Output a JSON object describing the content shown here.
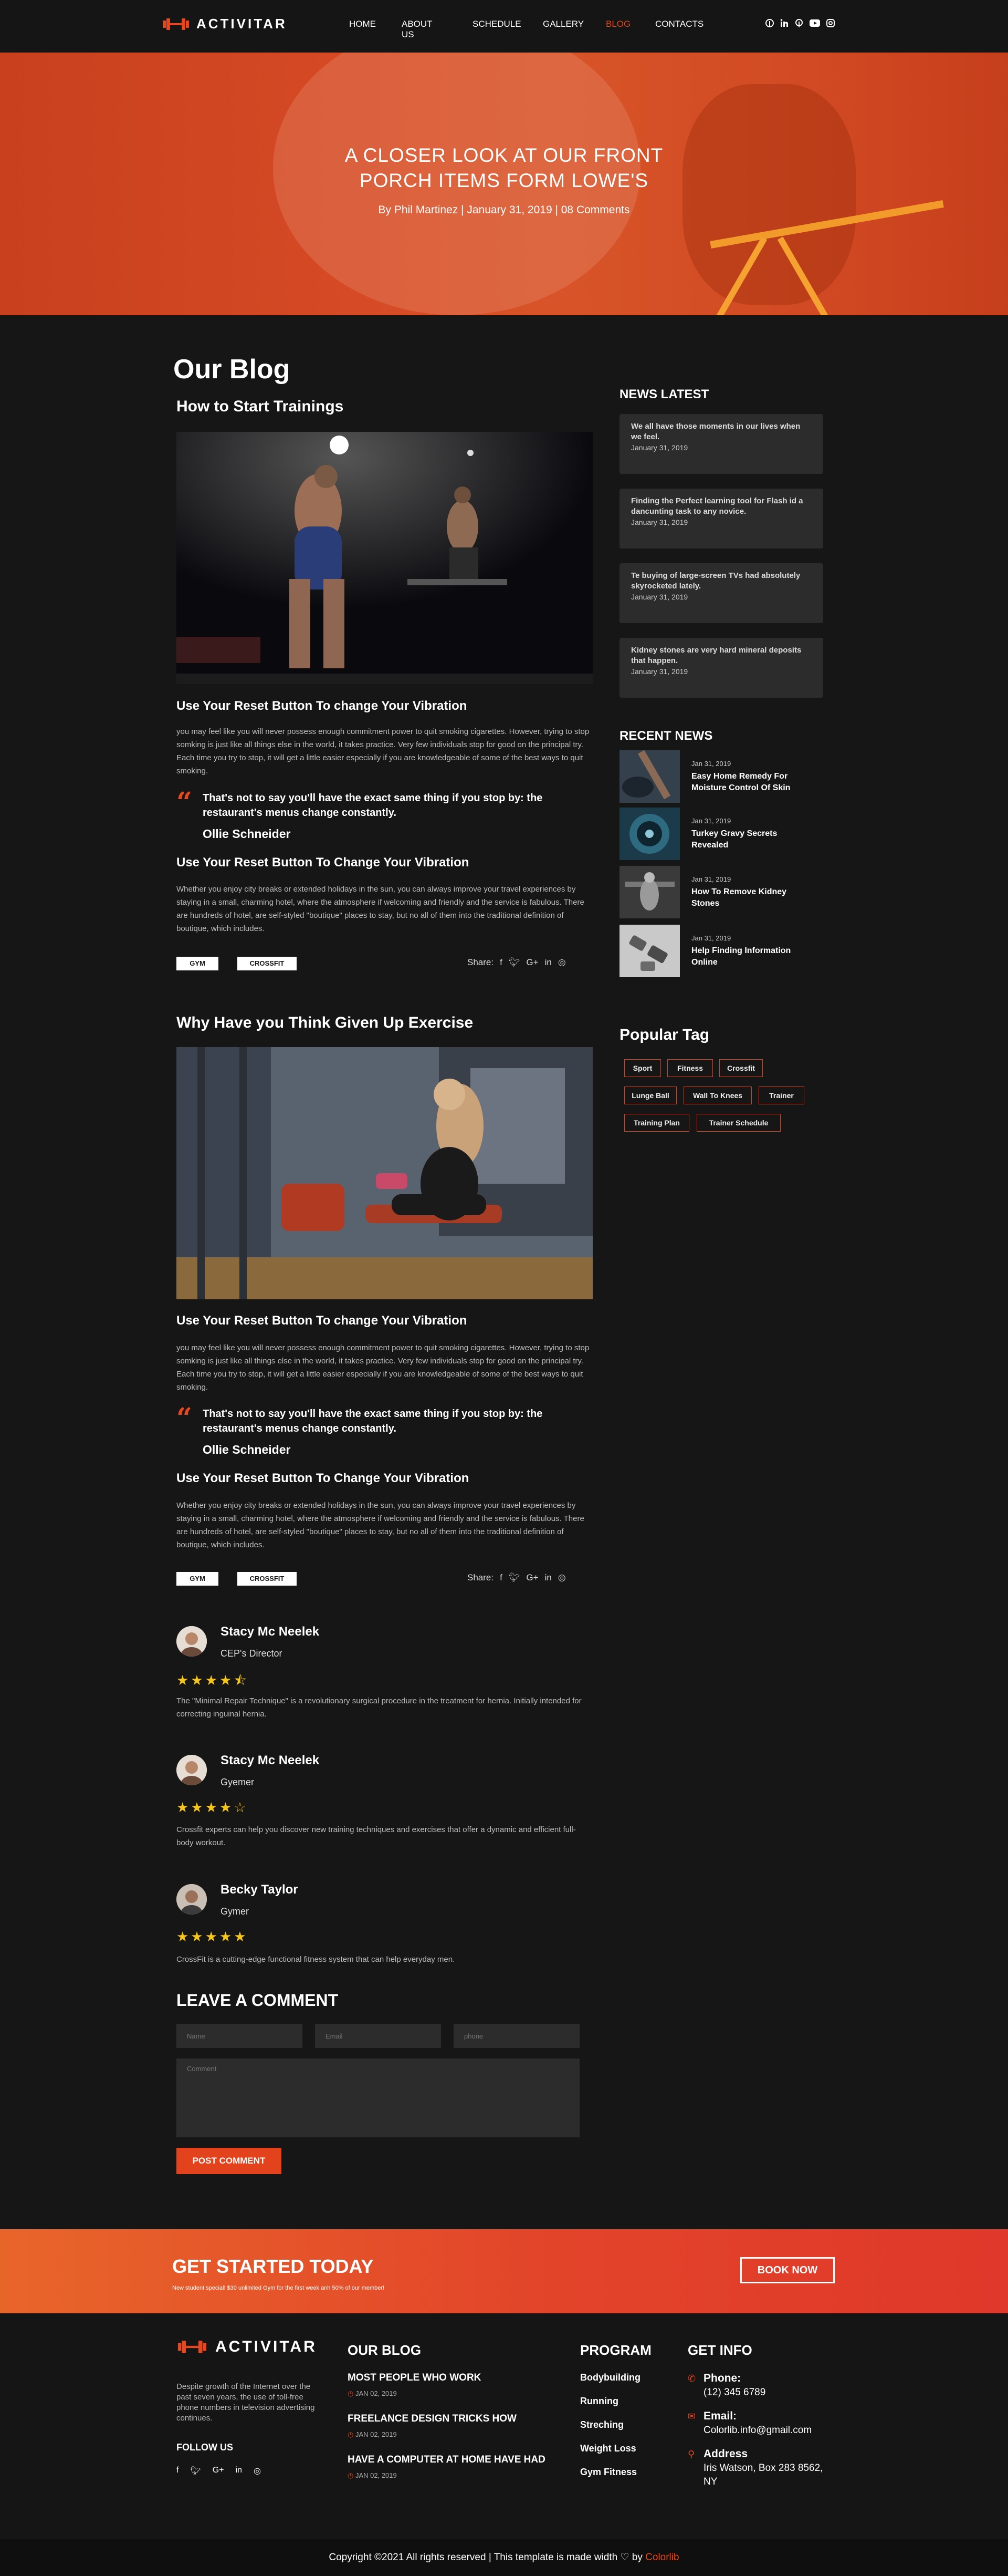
{
  "header": {
    "logo_text": "ACTIVITAR",
    "nav": [
      "HOME",
      "ABOUT US",
      "SCHEDULE",
      "GALLERY",
      "BLOG",
      "CONTACTS"
    ],
    "active_nav": "BLOG",
    "socials": [
      "pinterest-icon",
      "linkedin-icon",
      "pinterest-icon",
      "youtube-icon",
      "instagram-icon"
    ]
  },
  "hero": {
    "title_line1": "A CLOSER LOOK AT OUR FRONT",
    "title_line2": "PORCH ITEMS FORM LOWE'S",
    "meta": "By Phil Martinez  |  January 31, 2019  |  08 Comments"
  },
  "blog": {
    "heading": "Our Blog",
    "posts": [
      {
        "title": "How to Start Trainings",
        "sub1": "Use Your Reset Button To change Your Vibration",
        "para1": "you may feel like you will never possess enough commitment power to quit smoking cigarettes. However, trying to stop somking is just like all things else in the world, it takes practice. Very few individuals stop for good on the principal try. Each time you try to stop, it will get a little easier especially if you are knowledgeable of some of the best ways to quit smoking.",
        "quote": "That's not to say you'll have the exact same thing if you stop by: the restaurant's menus change constantly.",
        "quote_author": "Ollie Schneider",
        "sub2": "Use Your Reset Button To Change Your Vibration",
        "para2": "Whether you enjoy city breaks or extended holidays in the sun, you can always improve your travel experiences by staying in a small, charming hotel, where the atmosphere if welcoming and friendly and the service is fabulous. There are hundreds of hotel, are self-styled \"boutique\" places to stay, but no all of them into the traditional definition of boutique, which includes.",
        "tags": [
          "GYM",
          "CROSSFIT"
        ],
        "share_label": "Share:"
      },
      {
        "title": "Why Have you Think Given Up Exercise",
        "sub1": "Use Your Reset Button To change Your Vibration",
        "para1": "you may feel like you will never possess enough commitment power to quit smoking cigarettes. However, trying to stop somking is just like all things else in the world, it takes practice. Very few individuals stop for good on the principal try. Each time you try to stop, it will get a little easier especially if you are knowledgeable of some of the best ways to quit smoking.",
        "quote": "That's not to say you'll have the exact same thing if you stop by: the restaurant's menus change constantly.",
        "quote_author": "Ollie Schneider",
        "sub2": "Use Your Reset Button To Change Your Vibration",
        "para2": "Whether you enjoy city breaks or extended holidays in the sun, you can always improve your travel experiences by staying in a small, charming hotel, where the atmosphere if welcoming and friendly and the service is fabulous. There are hundreds of hotel, are self-styled \"boutique\" places to stay, but no all of them into the traditional definition of boutique, which includes.",
        "tags": [
          "GYM",
          "CROSSFIT"
        ],
        "share_label": "Share:"
      }
    ]
  },
  "sidebar": {
    "news_heading": "NEWS LATEST",
    "news": [
      {
        "title": "We all have those moments in our lives when we feel.",
        "date": "January 31, 2019"
      },
      {
        "title": "Finding the Perfect learning tool for Flash id a dancunting task to any novice.",
        "date": "January 31, 2019"
      },
      {
        "title": "Te buying of large-screen TVs had absolutely skyrocketed lately.",
        "date": "January 31, 2019"
      },
      {
        "title": "Kidney stones are very hard mineral deposits that happen.",
        "date": "January 31, 2019"
      }
    ],
    "recent_heading": "RECENT NEWS",
    "recent": [
      {
        "date": "Jan 31, 2019",
        "title": "Easy Home Remedy For Moisture Control Of Skin"
      },
      {
        "date": "Jan 31, 2019",
        "title": "Turkey Gravy Secrets Revealed"
      },
      {
        "date": "Jan 31, 2019",
        "title": "How To Remove Kidney Stones"
      },
      {
        "date": "Jan 31, 2019",
        "title": "Help Finding Information Online"
      }
    ],
    "tag_heading": "Popular Tag",
    "tags": [
      "Sport",
      "Fitness",
      "Crossfit",
      "Lunge Ball",
      "Wall To Knees",
      "Trainer",
      "Training Plan",
      "Trainer Schedule"
    ]
  },
  "reviews": [
    {
      "name": "Stacy Mc Neelek",
      "role": "CEP's Director",
      "rating": 4.5,
      "stars": "★★★★⯪",
      "text": "The \"Minimal Repair Technique\" is a revolutionary surgical procedure in the treatment for hernia. Initially intended for correcting inguinal hernia."
    },
    {
      "name": "Stacy Mc Neelek",
      "role": "Gyemer",
      "rating": 4,
      "stars": "★★★★☆",
      "text": "Crossfit experts can help you discover new training techniques and exercises that offer a dynamic and efficient full-body workout."
    },
    {
      "name": "Becky Taylor",
      "role": "Gymer",
      "rating": 5,
      "stars": "★★★★★",
      "text": "CrossFit is a cutting-edge functional fitness system that can help everyday men."
    }
  ],
  "comment": {
    "heading": "LEAVE A COMMENT",
    "name_placeholder": "Name",
    "email_placeholder": "Email",
    "phone_placeholder": "phone",
    "comment_placeholder": "Comment",
    "submit": "POST COMMENT"
  },
  "cta": {
    "title": "GET STARTED TODAY",
    "subtitle": "New student special! $30 unlimited Gym for the first week anh 50% of our member!",
    "button": "BOOK NOW"
  },
  "footer": {
    "logo_text": "ACTIVITAR",
    "about": "Despite growth of the Internet over the past seven years, the use of toll-free phone numbers in television advertising continues.",
    "follow_heading": "FOLLOW US",
    "follow_icons": [
      "facebook-icon",
      "twitter-icon",
      "google-plus-icon",
      "linkedin-icon",
      "instagram-icon"
    ],
    "blog_heading": "OUR BLOG",
    "blog_posts": [
      {
        "title": "MOST PEOPLE WHO WORK",
        "date": "JAN 02, 2019"
      },
      {
        "title": "FREELANCE DESIGN TRICKS HOW",
        "date": "JAN 02, 2019"
      },
      {
        "title": "HAVE A COMPUTER AT HOME HAVE HAD",
        "date": "JAN 02, 2019"
      }
    ],
    "program_heading": "PROGRAM",
    "programs": [
      "Bodybuilding",
      "Running",
      "Streching",
      "Weight Loss",
      "Gym Fitness"
    ],
    "info_heading": "GET INFO",
    "phone_label": "Phone:",
    "phone": "(12) 345 6789",
    "email_label": "Email:",
    "email": "Colorlib.info@gmail.com",
    "address_label": "Address",
    "address": "Iris Watson, Box 283 8562, NY",
    "copyright_prefix": "Copyright ©2021 All rights reserved | This template is made width ",
    "copyright_by": " by ",
    "copyright_brand": "Colorlib"
  },
  "colors": {
    "accent": "#e8461e",
    "background": "#161616",
    "card": "#2c2c2c",
    "star": "#f5c518"
  }
}
